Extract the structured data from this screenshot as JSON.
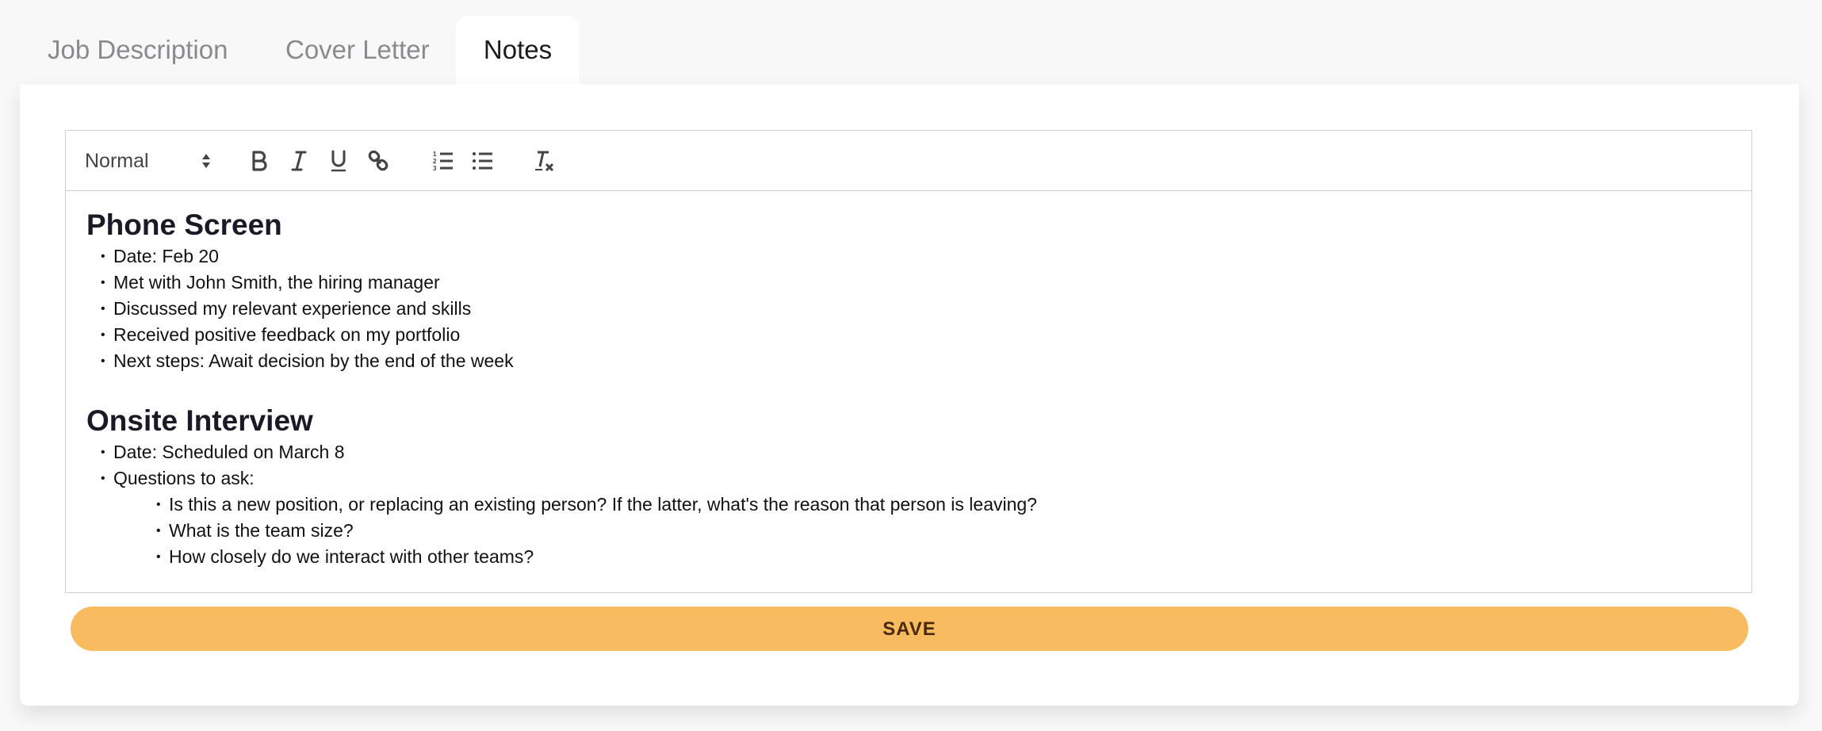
{
  "tabs": [
    {
      "label": "Job Description",
      "active": false
    },
    {
      "label": "Cover Letter",
      "active": false
    },
    {
      "label": "Notes",
      "active": true
    }
  ],
  "toolbar": {
    "format_select": {
      "value": "Normal",
      "icon": "up-down-arrows-icon"
    },
    "buttons": [
      {
        "name": "bold",
        "icon": "bold-icon"
      },
      {
        "name": "italic",
        "icon": "italic-icon"
      },
      {
        "name": "underline",
        "icon": "underline-icon"
      },
      {
        "name": "link",
        "icon": "link-icon"
      },
      {
        "name": "ordered-list",
        "icon": "ordered-list-icon"
      },
      {
        "name": "bullet-list",
        "icon": "bullet-list-icon"
      },
      {
        "name": "clear-formatting",
        "icon": "clear-formatting-icon"
      }
    ]
  },
  "notes": {
    "sections": [
      {
        "heading": "Phone Screen",
        "items": [
          "Date: Feb 20",
          "Met with John Smith, the hiring manager",
          "Discussed my relevant experience and skills",
          "Received positive feedback on my portfolio",
          "Next steps: Await decision by the end of the week"
        ]
      },
      {
        "heading": "Onsite Interview",
        "items": [
          "Date: Scheduled on March 8",
          "Questions to ask:"
        ],
        "nested_items": [
          "Is this a new position, or replacing an existing person? If the latter, what's the reason that person is leaving?",
          "What is the team size?",
          "How closely do we interact with other teams?"
        ]
      }
    ]
  },
  "save_button": {
    "label": "SAVE"
  },
  "colors": {
    "accent": "#f8bb5f",
    "accent_text": "#4a2a0c",
    "background": "#f8f8f8",
    "card": "#ffffff",
    "border": "#cfcfcf"
  }
}
